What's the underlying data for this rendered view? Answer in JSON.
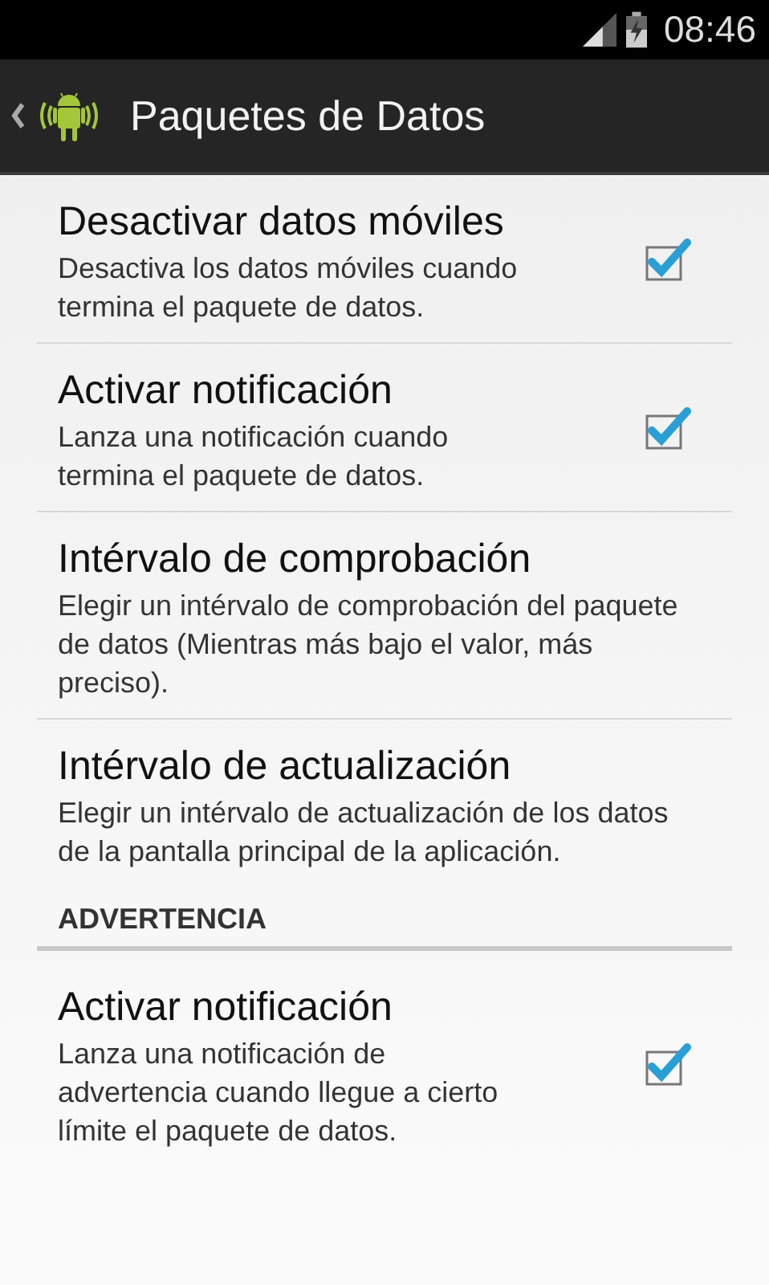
{
  "status_bar": {
    "time": "08:46"
  },
  "action_bar": {
    "title": "Paquetes de Datos"
  },
  "preferences": [
    {
      "kind": "checkbox",
      "title": "Desactivar datos móviles",
      "summary": "Desactiva los datos móviles cuando termina el paquete de datos.",
      "checked": true
    },
    {
      "kind": "checkbox",
      "title": "Activar notificación",
      "summary": "Lanza una notificación cuando termina el paquete de datos.",
      "checked": true
    },
    {
      "kind": "plain",
      "title": "Intérvalo de comprobación",
      "summary": "Elegir un intérvalo de comprobación del paquete de datos (Mientras más bajo el valor, más preciso)."
    },
    {
      "kind": "plain",
      "title": "Intérvalo de actualización",
      "summary": "Elegir un intérvalo de actualización de los datos de la pantalla principal de la aplicación."
    },
    {
      "kind": "category",
      "title": "ADVERTENCIA"
    },
    {
      "kind": "checkbox",
      "title": "Activar notificación",
      "summary": "Lanza una notificación de advertencia cuando llegue a cierto límite el paquete de datos.",
      "checked": true
    }
  ]
}
